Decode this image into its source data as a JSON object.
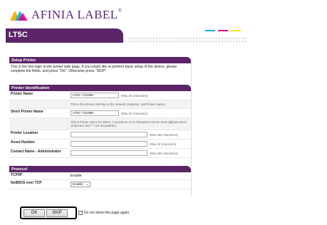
{
  "logo": {
    "text": "AFINIA LABEL",
    "tm": "®"
  },
  "header": {
    "title": "LT5C",
    "stripe_colors": [
      "#00aee8",
      "#e4007f",
      "#ffe600"
    ],
    "brand_color": "#5b2567"
  },
  "setup": {
    "heading": "Setup Printer",
    "message": "This is the first login to the printer web page. If you would like to perform basic setup of the device, please complete the fields, and press \"OK\". Otherwise press \"SKIP\"."
  },
  "identification": {
    "heading": "Printer Identification",
    "printer_name": {
      "label": "Printer Name",
      "value": "LT5C-715389",
      "hint": "(Max.20 characters)",
      "note": "This is the devices identity on the network (Systems, and Printer Name)."
    },
    "short_name": {
      "label": "Short Printer Name",
      "value": "LT5C-715389",
      "hint": "(Max.15 characters)",
      "note": "This is Printer Name for WINS. A maximum of 15 characters can be used (alphanumeric characters and \"-\" are acceptable.)"
    },
    "location": {
      "label": "Printer Location",
      "value": "",
      "hint": "(Max.255 characters)"
    },
    "asset": {
      "label": "Asset Number",
      "value": "",
      "hint": "(Max.32 characters)"
    },
    "contact": {
      "label": "Contact Name - Administrator",
      "value": "",
      "hint": "(Max.255 characters)"
    }
  },
  "protocol": {
    "heading": "Protocol",
    "tcpip": {
      "label": "TCP/IP",
      "value": "Enable"
    },
    "netbios": {
      "label": "NetBIOS over TCP",
      "selected": "Enable"
    }
  },
  "actions": {
    "ok_label": "OK",
    "skip_label": "SKIP",
    "dont_show_label": "Do not show this page again."
  }
}
